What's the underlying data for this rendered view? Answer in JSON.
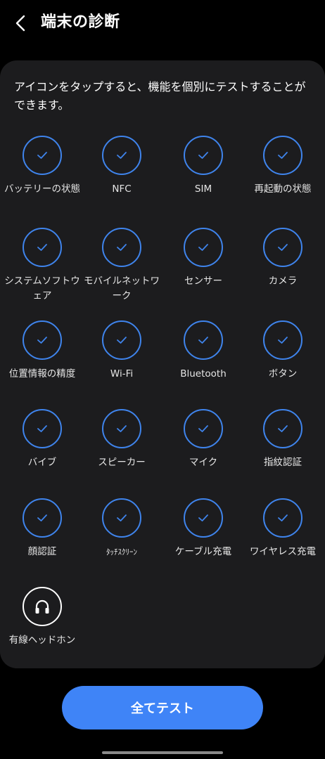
{
  "header": {
    "title": "端末の診断",
    "back_icon": "chevron-left-icon"
  },
  "intro_text": "アイコンをタップすると、機能を個別にテストすることができます。",
  "accent_color": "#3f84ec",
  "button_color": "#3f84f7",
  "tests": [
    {
      "key": "battery",
      "label": "バッテリーの状態",
      "status": "passed",
      "icon": "check-icon"
    },
    {
      "key": "nfc",
      "label": "NFC",
      "status": "passed",
      "icon": "check-icon"
    },
    {
      "key": "sim",
      "label": "SIM",
      "status": "passed",
      "icon": "check-icon"
    },
    {
      "key": "restart",
      "label": "再起動の状態",
      "status": "passed",
      "icon": "check-icon"
    },
    {
      "key": "system-software",
      "label": "システムソフトウェア",
      "status": "passed",
      "icon": "check-icon"
    },
    {
      "key": "mobile-network",
      "label": "モバイルネットワーク",
      "status": "passed",
      "icon": "check-icon"
    },
    {
      "key": "sensor",
      "label": "センサー",
      "status": "passed",
      "icon": "check-icon"
    },
    {
      "key": "camera",
      "label": "カメラ",
      "status": "passed",
      "icon": "check-icon"
    },
    {
      "key": "location-accuracy",
      "label": "位置情報の精度",
      "status": "passed",
      "icon": "check-icon"
    },
    {
      "key": "wifi",
      "label": "Wi-Fi",
      "status": "passed",
      "icon": "check-icon"
    },
    {
      "key": "bluetooth",
      "label": "Bluetooth",
      "status": "passed",
      "icon": "check-icon"
    },
    {
      "key": "buttons",
      "label": "ボタン",
      "status": "passed",
      "icon": "check-icon"
    },
    {
      "key": "vibration",
      "label": "バイブ",
      "status": "passed",
      "icon": "check-icon"
    },
    {
      "key": "speaker",
      "label": "スピーカー",
      "status": "passed",
      "icon": "check-icon"
    },
    {
      "key": "mic",
      "label": "マイク",
      "status": "passed",
      "icon": "check-icon"
    },
    {
      "key": "fingerprint",
      "label": "指紋認証",
      "status": "passed",
      "icon": "check-icon"
    },
    {
      "key": "face-recognition",
      "label": "顔認証",
      "status": "passed",
      "icon": "check-icon"
    },
    {
      "key": "touchscreen",
      "label": "ﾀｯﾁｽｸﾘｰﾝ",
      "status": "passed",
      "icon": "check-icon"
    },
    {
      "key": "cable-charging",
      "label": "ケーブル充電",
      "status": "passed",
      "icon": "check-icon"
    },
    {
      "key": "wireless-charging",
      "label": "ワイヤレス充電",
      "status": "passed",
      "icon": "check-icon"
    },
    {
      "key": "wired-headphones",
      "label": "有線ヘッドホン",
      "status": "untested",
      "icon": "headphones-icon"
    }
  ],
  "test_all_button": "全てテスト"
}
